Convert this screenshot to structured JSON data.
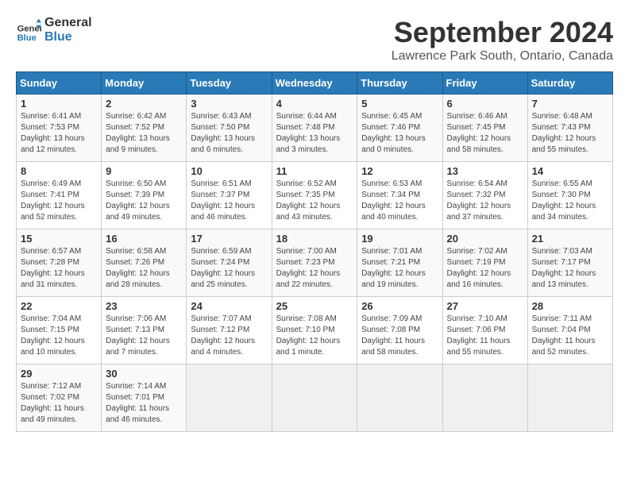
{
  "logo": {
    "line1": "General",
    "line2": "Blue"
  },
  "title": "September 2024",
  "location": "Lawrence Park South, Ontario, Canada",
  "weekdays": [
    "Sunday",
    "Monday",
    "Tuesday",
    "Wednesday",
    "Thursday",
    "Friday",
    "Saturday"
  ],
  "weeks": [
    [
      {
        "day": "1",
        "sunrise": "6:41 AM",
        "sunset": "7:53 PM",
        "daylight": "13 hours and 12 minutes."
      },
      {
        "day": "2",
        "sunrise": "6:42 AM",
        "sunset": "7:52 PM",
        "daylight": "13 hours and 9 minutes."
      },
      {
        "day": "3",
        "sunrise": "6:43 AM",
        "sunset": "7:50 PM",
        "daylight": "13 hours and 6 minutes."
      },
      {
        "day": "4",
        "sunrise": "6:44 AM",
        "sunset": "7:48 PM",
        "daylight": "13 hours and 3 minutes."
      },
      {
        "day": "5",
        "sunrise": "6:45 AM",
        "sunset": "7:46 PM",
        "daylight": "13 hours and 0 minutes."
      },
      {
        "day": "6",
        "sunrise": "6:46 AM",
        "sunset": "7:45 PM",
        "daylight": "12 hours and 58 minutes."
      },
      {
        "day": "7",
        "sunrise": "6:48 AM",
        "sunset": "7:43 PM",
        "daylight": "12 hours and 55 minutes."
      }
    ],
    [
      {
        "day": "8",
        "sunrise": "6:49 AM",
        "sunset": "7:41 PM",
        "daylight": "12 hours and 52 minutes."
      },
      {
        "day": "9",
        "sunrise": "6:50 AM",
        "sunset": "7:39 PM",
        "daylight": "12 hours and 49 minutes."
      },
      {
        "day": "10",
        "sunrise": "6:51 AM",
        "sunset": "7:37 PM",
        "daylight": "12 hours and 46 minutes."
      },
      {
        "day": "11",
        "sunrise": "6:52 AM",
        "sunset": "7:35 PM",
        "daylight": "12 hours and 43 minutes."
      },
      {
        "day": "12",
        "sunrise": "6:53 AM",
        "sunset": "7:34 PM",
        "daylight": "12 hours and 40 minutes."
      },
      {
        "day": "13",
        "sunrise": "6:54 AM",
        "sunset": "7:32 PM",
        "daylight": "12 hours and 37 minutes."
      },
      {
        "day": "14",
        "sunrise": "6:55 AM",
        "sunset": "7:30 PM",
        "daylight": "12 hours and 34 minutes."
      }
    ],
    [
      {
        "day": "15",
        "sunrise": "6:57 AM",
        "sunset": "7:28 PM",
        "daylight": "12 hours and 31 minutes."
      },
      {
        "day": "16",
        "sunrise": "6:58 AM",
        "sunset": "7:26 PM",
        "daylight": "12 hours and 28 minutes."
      },
      {
        "day": "17",
        "sunrise": "6:59 AM",
        "sunset": "7:24 PM",
        "daylight": "12 hours and 25 minutes."
      },
      {
        "day": "18",
        "sunrise": "7:00 AM",
        "sunset": "7:23 PM",
        "daylight": "12 hours and 22 minutes."
      },
      {
        "day": "19",
        "sunrise": "7:01 AM",
        "sunset": "7:21 PM",
        "daylight": "12 hours and 19 minutes."
      },
      {
        "day": "20",
        "sunrise": "7:02 AM",
        "sunset": "7:19 PM",
        "daylight": "12 hours and 16 minutes."
      },
      {
        "day": "21",
        "sunrise": "7:03 AM",
        "sunset": "7:17 PM",
        "daylight": "12 hours and 13 minutes."
      }
    ],
    [
      {
        "day": "22",
        "sunrise": "7:04 AM",
        "sunset": "7:15 PM",
        "daylight": "12 hours and 10 minutes."
      },
      {
        "day": "23",
        "sunrise": "7:06 AM",
        "sunset": "7:13 PM",
        "daylight": "12 hours and 7 minutes."
      },
      {
        "day": "24",
        "sunrise": "7:07 AM",
        "sunset": "7:12 PM",
        "daylight": "12 hours and 4 minutes."
      },
      {
        "day": "25",
        "sunrise": "7:08 AM",
        "sunset": "7:10 PM",
        "daylight": "12 hours and 1 minute."
      },
      {
        "day": "26",
        "sunrise": "7:09 AM",
        "sunset": "7:08 PM",
        "daylight": "11 hours and 58 minutes."
      },
      {
        "day": "27",
        "sunrise": "7:10 AM",
        "sunset": "7:06 PM",
        "daylight": "11 hours and 55 minutes."
      },
      {
        "day": "28",
        "sunrise": "7:11 AM",
        "sunset": "7:04 PM",
        "daylight": "11 hours and 52 minutes."
      }
    ],
    [
      {
        "day": "29",
        "sunrise": "7:12 AM",
        "sunset": "7:02 PM",
        "daylight": "11 hours and 49 minutes."
      },
      {
        "day": "30",
        "sunrise": "7:14 AM",
        "sunset": "7:01 PM",
        "daylight": "11 hours and 46 minutes."
      },
      null,
      null,
      null,
      null,
      null
    ]
  ]
}
